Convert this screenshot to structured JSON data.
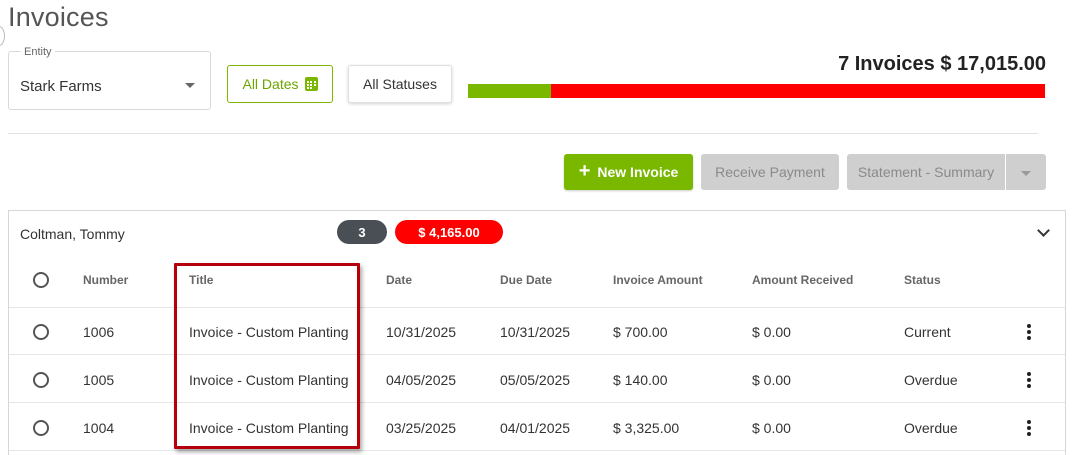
{
  "page": {
    "title": "Invoices"
  },
  "filters": {
    "entity_label": "Entity",
    "entity_value": "Stark Farms",
    "dates_label": "All Dates",
    "statuses_label": "All Statuses"
  },
  "summary": {
    "text": "7 Invoices $ 17,015.00",
    "paid_fraction": 0.143,
    "colors": {
      "paid": "#7ab800",
      "unpaid": "#ff0000"
    }
  },
  "actions": {
    "new_invoice": "New Invoice",
    "receive_payment": "Receive Payment",
    "statement": "Statement - Summary"
  },
  "group": {
    "customer": "Coltman, Tommy",
    "count": "3",
    "amount": "$ 4,165.00"
  },
  "table": {
    "headers": [
      "Number",
      "Title",
      "Date",
      "Due Date",
      "Invoice Amount",
      "Amount Received",
      "Status"
    ],
    "rows": [
      {
        "number": "1006",
        "title": "Invoice - Custom Planting",
        "date": "10/31/2025",
        "due_date": "10/31/2025",
        "amount": "$ 700.00",
        "received": "$ 0.00",
        "status": "Current"
      },
      {
        "number": "1005",
        "title": "Invoice - Custom Planting",
        "date": "04/05/2025",
        "due_date": "05/05/2025",
        "amount": "$ 140.00",
        "received": "$ 0.00",
        "status": "Overdue"
      },
      {
        "number": "1004",
        "title": "Invoice - Custom Planting",
        "date": "03/25/2025",
        "due_date": "04/01/2025",
        "amount": "$ 3,325.00",
        "received": "$ 0.00",
        "status": "Overdue"
      }
    ]
  },
  "icons": {
    "calendar": "calendar-icon",
    "plus": "plus-icon",
    "chevron": "chevron-down-icon",
    "kebab": "more-vertical-icon",
    "plus_glyph": "+"
  }
}
